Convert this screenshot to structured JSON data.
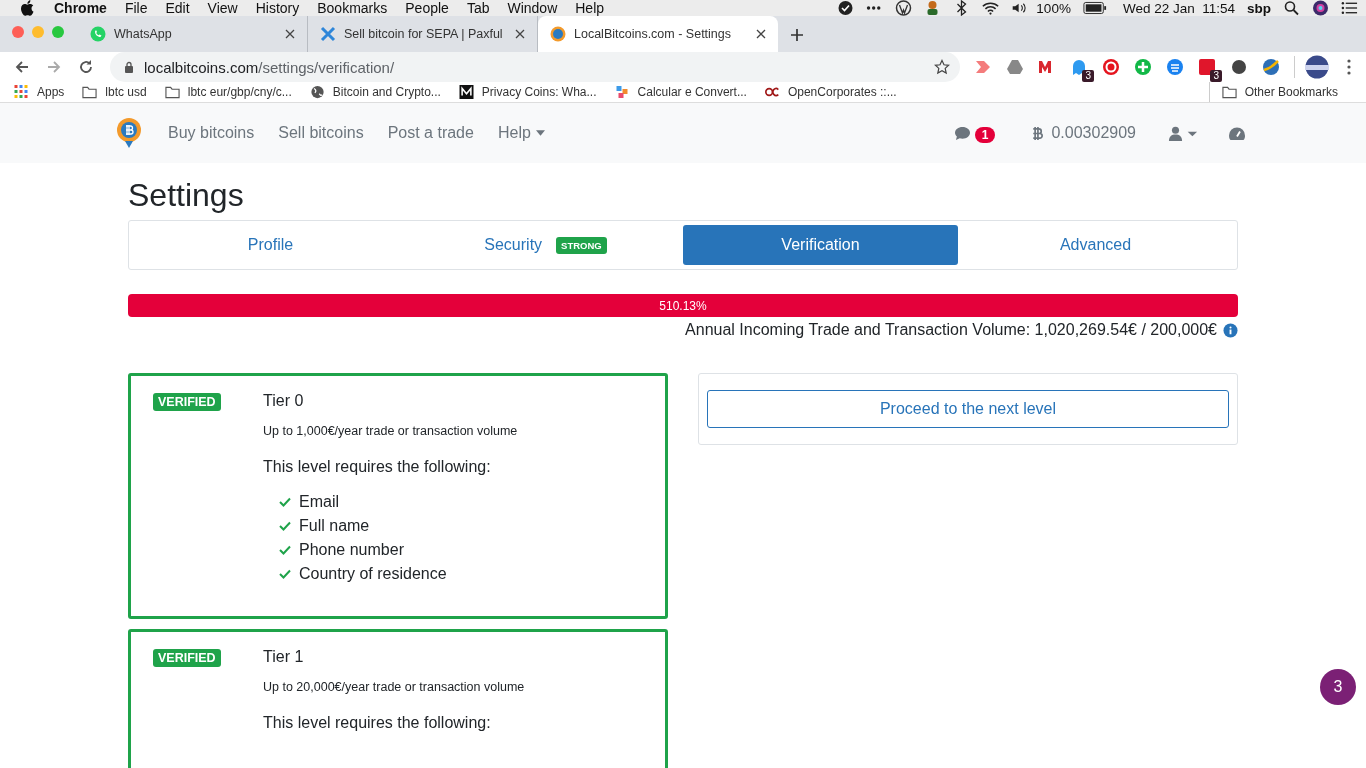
{
  "menu_bar": {
    "app": "Chrome",
    "items": [
      "File",
      "Edit",
      "View",
      "History",
      "Bookmarks",
      "People",
      "Tab",
      "Window",
      "Help"
    ],
    "battery": "100%",
    "clock": "Wed 22 Jan  11:54",
    "user": "sbp"
  },
  "tabs": [
    {
      "title": "WhatsApp",
      "selected": false,
      "kind": "whatsapp"
    },
    {
      "title": "Sell bitcoin for SEPA | Paxful",
      "selected": false,
      "kind": "paxful"
    },
    {
      "title": "LocalBitcoins.com - Settings",
      "selected": true,
      "kind": "lbtc"
    }
  ],
  "address": {
    "host": "localbitcoins.com",
    "path": "/settings/verification/"
  },
  "extensions": [
    {
      "kind": "arrow"
    },
    {
      "kind": "drive"
    },
    {
      "kind": "mega"
    },
    {
      "kind": "ghost",
      "badge": "3"
    },
    {
      "kind": "ring"
    },
    {
      "kind": "plus"
    },
    {
      "kind": "lines"
    },
    {
      "kind": "dots",
      "badge": "3"
    },
    {
      "kind": "figure"
    },
    {
      "kind": "swirl"
    }
  ],
  "bookmarks": [
    {
      "label": "Apps",
      "kind": "apps"
    },
    {
      "label": "lbtc usd",
      "kind": "folder"
    },
    {
      "label": "lbtc eur/gbp/cny/c...",
      "kind": "folder"
    },
    {
      "label": "Bitcoin and Crypto...",
      "kind": "globe"
    },
    {
      "label": "Privacy Coins: Wha...",
      "kind": "medium"
    },
    {
      "label": "Calcular e Convert...",
      "kind": "squares"
    },
    {
      "label": "OpenCorporates ::...",
      "kind": "oc"
    }
  ],
  "other_bookmarks": "Other Bookmarks",
  "site_nav": {
    "links": [
      "Buy bitcoins",
      "Sell bitcoins",
      "Post a trade",
      "Help"
    ],
    "messages": "1",
    "balance": "0.00302909"
  },
  "page_title": "Settings",
  "settings_tabs": [
    {
      "label": "Profile",
      "selected": false
    },
    {
      "label": "Security",
      "selected": false,
      "badge": "STRONG"
    },
    {
      "label": "Verification",
      "selected": true
    },
    {
      "label": "Advanced",
      "selected": false
    }
  ],
  "volume": {
    "level": 1,
    "percent": "510.13%",
    "caption": "Annual Incoming Trade and Transaction Volume: 1,020,269.54€ / 200,000€"
  },
  "tiers": [
    {
      "status": "VERIFIED",
      "name": "Tier 0",
      "limit": "Up to 1,000€/year trade or transaction volume",
      "requires": "This level requires the following:",
      "items": [
        "Email",
        "Full name",
        "Phone number",
        "Country of residence"
      ]
    },
    {
      "status": "VERIFIED",
      "name": "Tier 1",
      "limit": "Up to 20,000€/year trade or transaction volume",
      "requires": "This level requires the following:"
    }
  ],
  "next_level_button": "Proceed to the next level",
  "chat_badge": "3"
}
